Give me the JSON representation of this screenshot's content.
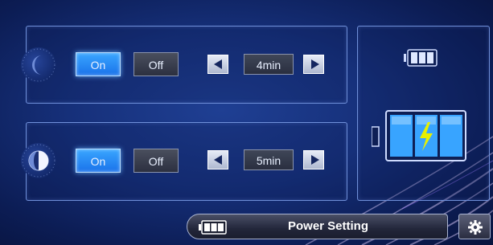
{
  "rows": [
    {
      "mode_icon": "moon-icon",
      "on_label": "On",
      "off_label": "Off",
      "value": "4min",
      "selected": "On"
    },
    {
      "mode_icon": "half-moon-icon",
      "on_label": "On",
      "off_label": "Off",
      "value": "5min",
      "selected": "On"
    }
  ],
  "bottom": {
    "title": "Power Setting",
    "battery_icon": "battery-icon",
    "settings_icon": "gear-icon"
  },
  "side_panel": {
    "status_icon": "battery-small-icon",
    "charging_icon": "battery-charging-icon"
  },
  "colors": {
    "accent": "#2a8cf5",
    "background": "#16307a",
    "panel_border": "#6f8fd9",
    "bolt": "#e8f000"
  }
}
